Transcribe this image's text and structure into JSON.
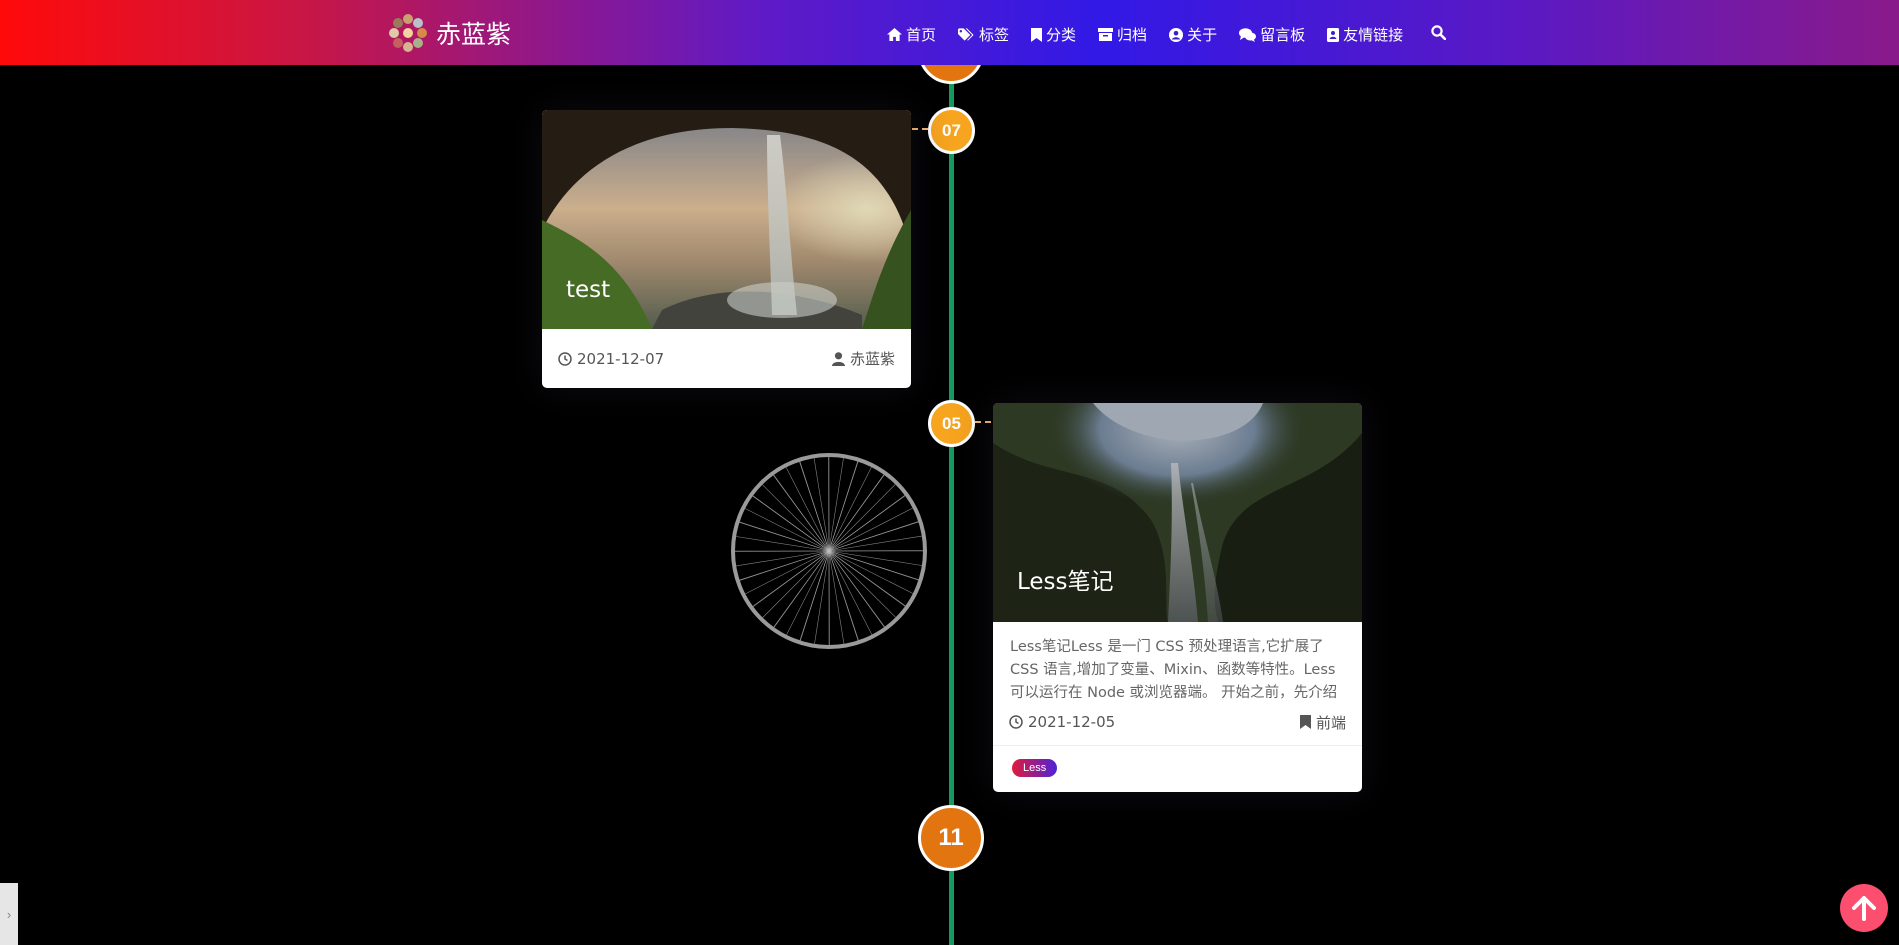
{
  "site": {
    "name": "赤蓝紫"
  },
  "nav": {
    "items": [
      {
        "label": "首页",
        "icon": "home-icon"
      },
      {
        "label": "标签",
        "icon": "tags-icon"
      },
      {
        "label": "分类",
        "icon": "bookmark-icon"
      },
      {
        "label": "归档",
        "icon": "archive-icon"
      },
      {
        "label": "关于",
        "icon": "user-circle-icon"
      },
      {
        "label": "留言板",
        "icon": "comments-icon"
      },
      {
        "label": "友情链接",
        "icon": "address-book-icon"
      }
    ],
    "search_icon": "search-icon"
  },
  "timeline": {
    "month_label": "11",
    "posts": [
      {
        "day": "07",
        "title": "test",
        "date": "2021-12-07",
        "author": "赤蓝紫"
      },
      {
        "day": "05",
        "title": "Less笔记",
        "excerpt": "Less笔记Less 是一门 CSS 预处理语言,它扩展了 CSS 语言,增加了变量、Mixin、函数等特性。Less 可以运行在 Node 或浏览器端。 开始之前，先介绍一个...",
        "date": "2021-12-05",
        "category": "前端",
        "tag": "Less"
      }
    ]
  },
  "colors": {
    "timeline_line": "#169b5f",
    "day_node": "#f7a41f",
    "month_node": "#e27510",
    "back_to_top": "#fc4e6e"
  }
}
